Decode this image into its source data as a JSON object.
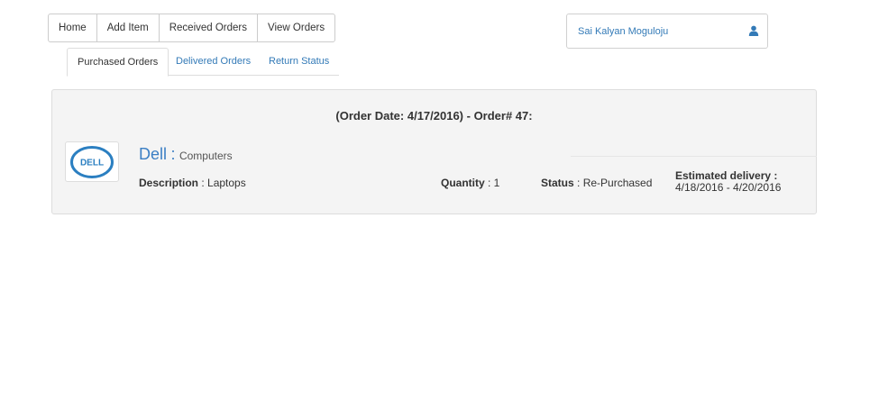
{
  "topnav": {
    "items": [
      "Home",
      "Add Item",
      "Received Orders",
      "View Orders"
    ]
  },
  "user": {
    "name": "Sai Kalyan Moguloju",
    "icon": "user-icon"
  },
  "tabs": {
    "items": [
      "Purchased Orders",
      "Delivered Orders",
      "Return Status"
    ],
    "active": "Purchased Orders"
  },
  "order": {
    "header": "(Order Date: 4/17/2016) - Order# 47:",
    "logo_text": "DELL",
    "brand": "Dell",
    "brand_sep": ":",
    "category": "Computers",
    "description_label": "Description",
    "description_value": ": Laptops",
    "quantity_label": "Quantity",
    "quantity_value": ": 1",
    "status_label": "Status",
    "status_value": ": Re-Purchased",
    "delivery_label": "Estimated delivery :",
    "delivery_value": "4/18/2016 - 4/20/2016"
  },
  "colors": {
    "link": "#337ab7",
    "panel_bg": "#f4f4f4",
    "dell_blue": "#2b7fc1"
  }
}
